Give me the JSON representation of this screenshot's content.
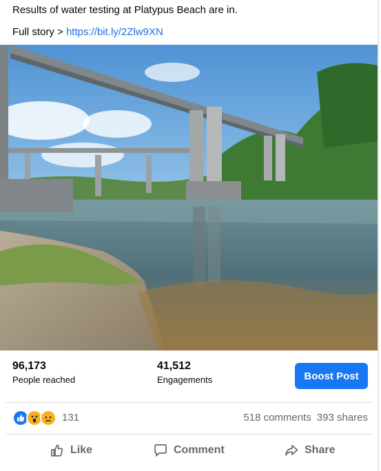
{
  "post": {
    "caption_line1": "Results of water testing at Platypus Beach are in.",
    "caption_prefix": "Full story > ",
    "caption_link": "https://bit.ly/2Zlw9XN"
  },
  "insights": {
    "reach_value": "96,173",
    "reach_label": "People reached",
    "engagements_value": "41,512",
    "engagements_label": "Engagements",
    "boost_label": "Boost Post"
  },
  "reactions": {
    "emoji_icons": [
      "like-icon",
      "wow-icon",
      "sad-icon"
    ],
    "count": "131",
    "comments": "518 comments",
    "shares": "393 shares"
  },
  "actions": {
    "like": "Like",
    "comment": "Comment",
    "share": "Share"
  },
  "colors": {
    "accent": "#1877f2",
    "link": "#216fdb",
    "secondary_text": "#65676b"
  }
}
